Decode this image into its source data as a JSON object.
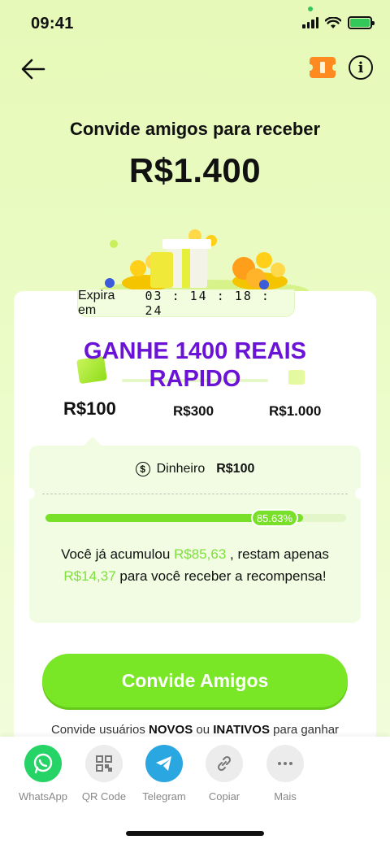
{
  "status_bar": {
    "time": "09:41"
  },
  "header": {
    "headline": "Convide amigos para receber",
    "amount": "R$1.400"
  },
  "expiry": {
    "label": "Expira em",
    "timer": "03 : 14 : 18 : 24"
  },
  "promo": {
    "line1": "GANHE 1400 REAIS",
    "line2": "RAPIDO"
  },
  "tiers": [
    "R$100",
    "R$300",
    "R$1.000"
  ],
  "reward": {
    "cash_label": "Dinheiro",
    "cash_value": "R$100",
    "progress_percent": 85.63,
    "progress_label": "85.63%",
    "msg_part1": "Você já acumulou ",
    "accumulated": "R$85,63",
    "msg_part2": " , restam apenas ",
    "remaining": "R$14,37",
    "msg_part3": " para você receber a recompensa!"
  },
  "cta": {
    "label": "Convide Amigos"
  },
  "invite_note": {
    "part1": "Convide usuários ",
    "bold1": "NOVOS",
    "part2": " ou ",
    "bold2": "INATIVOS",
    "part3": " para ganhar"
  },
  "share": [
    {
      "label": "WhatsApp",
      "icon": "whatsapp-icon"
    },
    {
      "label": "QR Code",
      "icon": "qr-code-icon"
    },
    {
      "label": "Telegram",
      "icon": "telegram-icon"
    },
    {
      "label": "Copiar",
      "icon": "link-icon"
    },
    {
      "label": "Mais",
      "icon": "more-icon"
    }
  ],
  "colors": {
    "accent": "#79e626",
    "promo": "#6a13d6",
    "highlight": "#7ee03b"
  }
}
